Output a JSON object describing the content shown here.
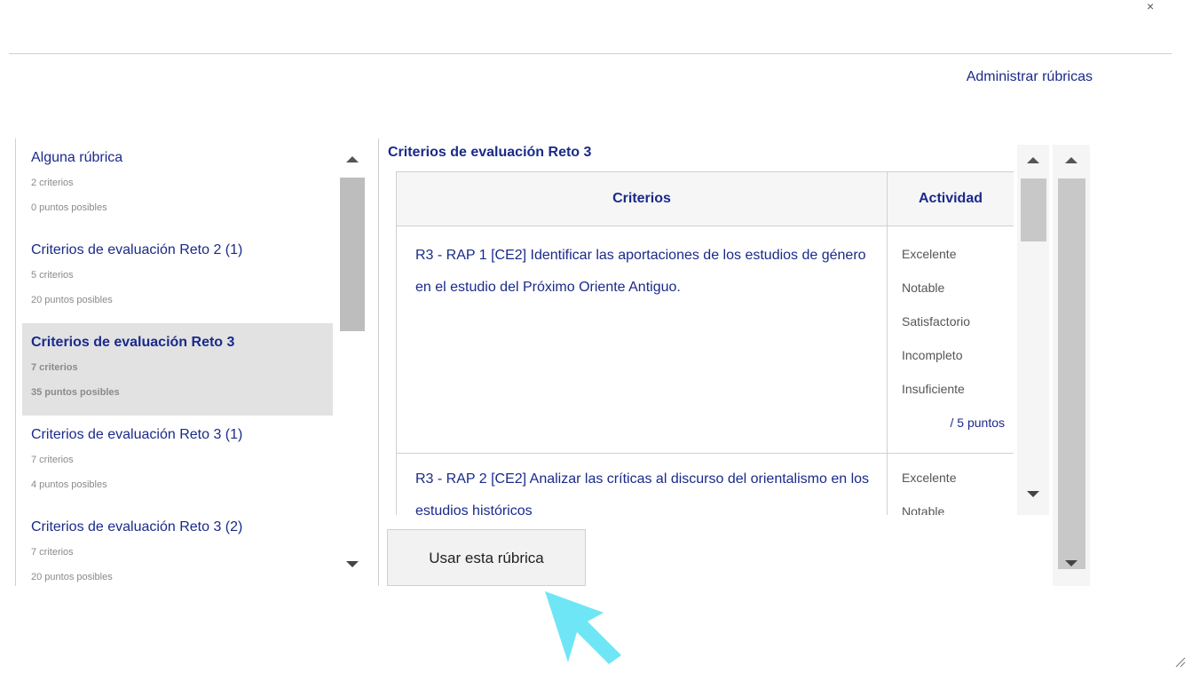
{
  "header": {
    "close_glyph": "×",
    "manage_link": "Administrar rúbricas"
  },
  "rubrics": [
    {
      "name": "Alguna rúbrica",
      "criteria": "2 criterios",
      "points": "0 puntos posibles",
      "selected": false
    },
    {
      "name": "Criterios de evaluación Reto 2 (1)",
      "criteria": "5 criterios",
      "points": "20 puntos posibles",
      "selected": false
    },
    {
      "name": "Criterios de evaluación Reto 3",
      "criteria": "7 criterios",
      "points": "35 puntos posibles",
      "selected": true
    },
    {
      "name": "Criterios de evaluación Reto 3 (1)",
      "criteria": "7 criterios",
      "points": "4 puntos posibles",
      "selected": false
    },
    {
      "name": "Criterios de evaluación Reto 3 (2)",
      "criteria": "7 criterios",
      "points": "20 puntos posibles",
      "selected": false
    }
  ],
  "detail": {
    "title": "Criterios de evaluación Reto 3",
    "col_criteria": "Criterios",
    "col_activity": "Actividad",
    "rows": [
      {
        "text": "R3 - RAP 1 [CE2] Identificar las aportaciones de los estudios de género en el estudio del Próximo Oriente Antiguo.",
        "levels": [
          "Excelente",
          "Notable",
          "Satisfactorio",
          "Incompleto",
          "Insuficiente"
        ],
        "points": "/ 5 puntos"
      },
      {
        "text": "R3 - RAP 2 [CE2] Analizar las críticas al discurso del orientalismo en los estudios históricos",
        "levels": [
          "Excelente",
          "Notable"
        ],
        "points": ""
      }
    ]
  },
  "actions": {
    "use_button": "Usar esta rúbrica"
  },
  "colors": {
    "link": "#1a2a8a",
    "selected_bg": "#e2e2e2",
    "cursor": "#6ee6f5"
  }
}
